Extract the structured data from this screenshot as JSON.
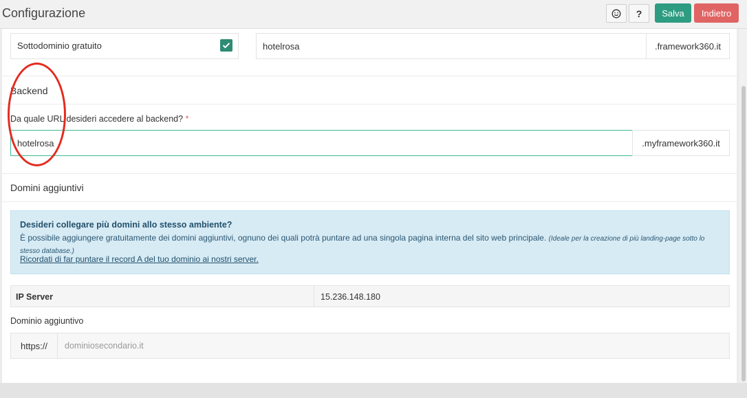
{
  "header": {
    "title": "Configurazione",
    "help_label": "?",
    "save_label": "Salva",
    "back_label": "Indietro"
  },
  "subdomain": {
    "label": "Sottodominio gratuito",
    "checked": true,
    "value": "hotelrosa",
    "suffix": ".framework360.it"
  },
  "backend": {
    "section_title": "Backend",
    "question": "Da quale URL desideri accedere al backend?",
    "required_mark": "*",
    "value": "hotelrosa",
    "suffix": ".myframework360.it"
  },
  "extra_domains": {
    "section_title": "Domini aggiuntivi",
    "info_title": "Desideri collegare più domini allo stesso ambiente?",
    "info_text": "È possibile aggiungere gratuitamente dei domini aggiuntivi, ognuno dei quali potrà puntare ad una singola pagina interna del sito web principale.",
    "info_note": "(Ideale per la creazione di più landing-page sotto lo stesso database.)",
    "info_link": "Ricordati di far puntare il record A del tuo dominio ai nostri server.",
    "ip_label": "IP Server",
    "ip_value": "15.236.148.180",
    "field_label": "Dominio aggiuntivo",
    "url_prefix": "https://",
    "url_placeholder": "dominiosecondario.it"
  },
  "colors": {
    "save": "#2e9c81",
    "back": "#e06464",
    "annotation": "#e32b20",
    "info_bg": "#d7ebf5"
  }
}
